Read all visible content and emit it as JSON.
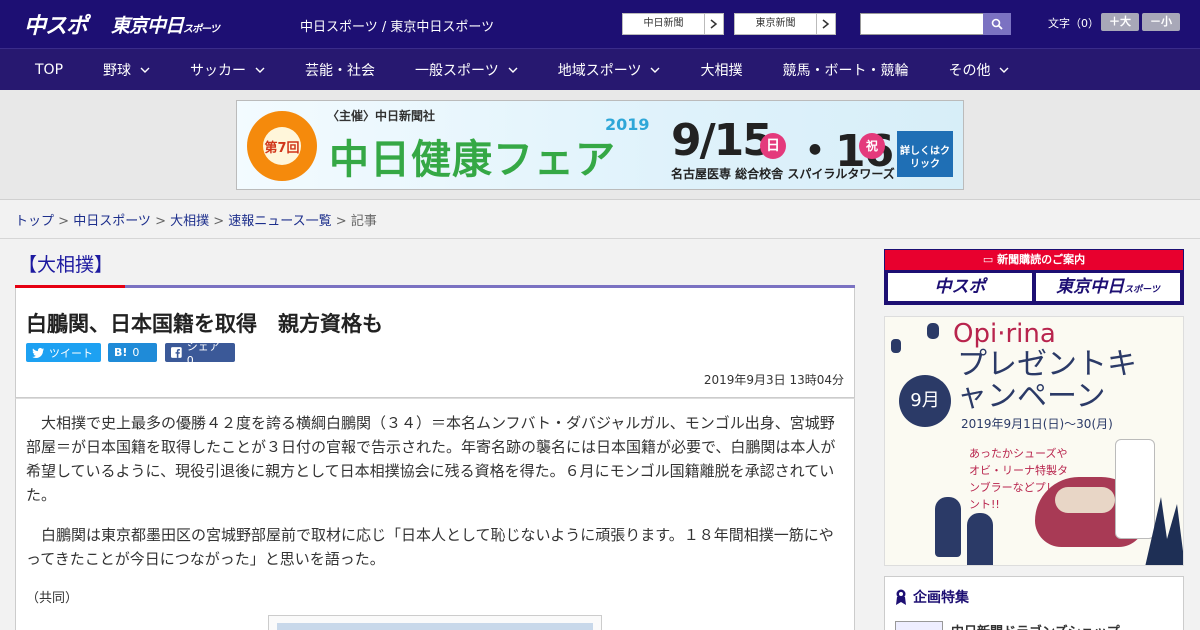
{
  "header": {
    "logo_chuspo": "中スポ",
    "logo_tokyo": "東京中日",
    "logo_tokyo_sub": "スポーツ",
    "site_names": "中日スポーツ / 東京中日スポーツ",
    "link_chunichi": "中日新聞",
    "link_tokyo": "東京新聞",
    "search_placeholder": "",
    "font_size_label": "文字（0）",
    "font_plus": "＋大",
    "font_minus": "－小"
  },
  "nav": [
    {
      "label": "TOP",
      "dropdown": false
    },
    {
      "label": "野球",
      "dropdown": true
    },
    {
      "label": "サッカー",
      "dropdown": true
    },
    {
      "label": "芸能・社会",
      "dropdown": false
    },
    {
      "label": "一般スポーツ",
      "dropdown": true
    },
    {
      "label": "地域スポーツ",
      "dropdown": true
    },
    {
      "label": "大相撲",
      "dropdown": false
    },
    {
      "label": "競馬・ボート・競輪",
      "dropdown": false
    },
    {
      "label": "その他",
      "dropdown": true
    }
  ],
  "banner": {
    "badge": "第7回",
    "host": "〈主催〉中日新聞社",
    "year": "2019",
    "title": "中日健康フェア",
    "date1": "9/15",
    "day1": "日",
    "date2": "・16",
    "day2": "祝",
    "venue": "名古屋医専 総合校舎 スパイラルタワーズ",
    "cta": "詳しくはクリック"
  },
  "breadcrumb": [
    {
      "label": "トップ",
      "link": true
    },
    {
      "label": "中日スポーツ",
      "link": true
    },
    {
      "label": "大相撲",
      "link": true
    },
    {
      "label": "速報ニュース一覧",
      "link": true
    },
    {
      "label": "記事",
      "link": false
    }
  ],
  "article": {
    "category": "【大相撲】",
    "title": "白鵬関、日本国籍を取得　親方資格も",
    "share_tweet": "ツイート",
    "share_hatena": "0",
    "share_fb": "シェア 0",
    "date": "2019年9月3日 13時04分",
    "paragraphs": [
      "大相撲で史上最多の優勝４２度を誇る横綱白鵬関（３４）＝本名ムンフバト・ダバジャルガル、モンゴル出身、宮城野部屋＝が日本国籍を取得したことが３日付の官報で告示された。年寄名跡の襲名には日本国籍が必要で、白鵬関は本人が希望しているように、現役引退後に親方として日本相撲協会に残る資格を得た。６月にモンゴル国籍離脱を承認されていた。",
      "白鵬関は東京都墨田区の宮城野部屋前で取材に応じ「日本人として恥じないように頑張ります。１８年間相撲一筋にやってきたことが今日につながった」と思いを語った。"
    ],
    "credit": "（共同）"
  },
  "sidebar": {
    "subscribe_head": "新聞購読のご案内",
    "subscribe_logo1": "中スポ",
    "subscribe_logo2": "東京中日",
    "subscribe_logo2_sub": "スポーツ",
    "promo_brand": "Opi·rina",
    "promo_title": "プレゼントキャンペーン",
    "promo_month": "9月",
    "promo_period": "2019年9月1日(日)〜30(月)",
    "promo_tag": "あったかシューズやオビ・リーナ特製タンブラーなどプレゼント!!",
    "feature_head": "企画特集",
    "feature_item": "中日新聞ドラゴンズショップ"
  }
}
